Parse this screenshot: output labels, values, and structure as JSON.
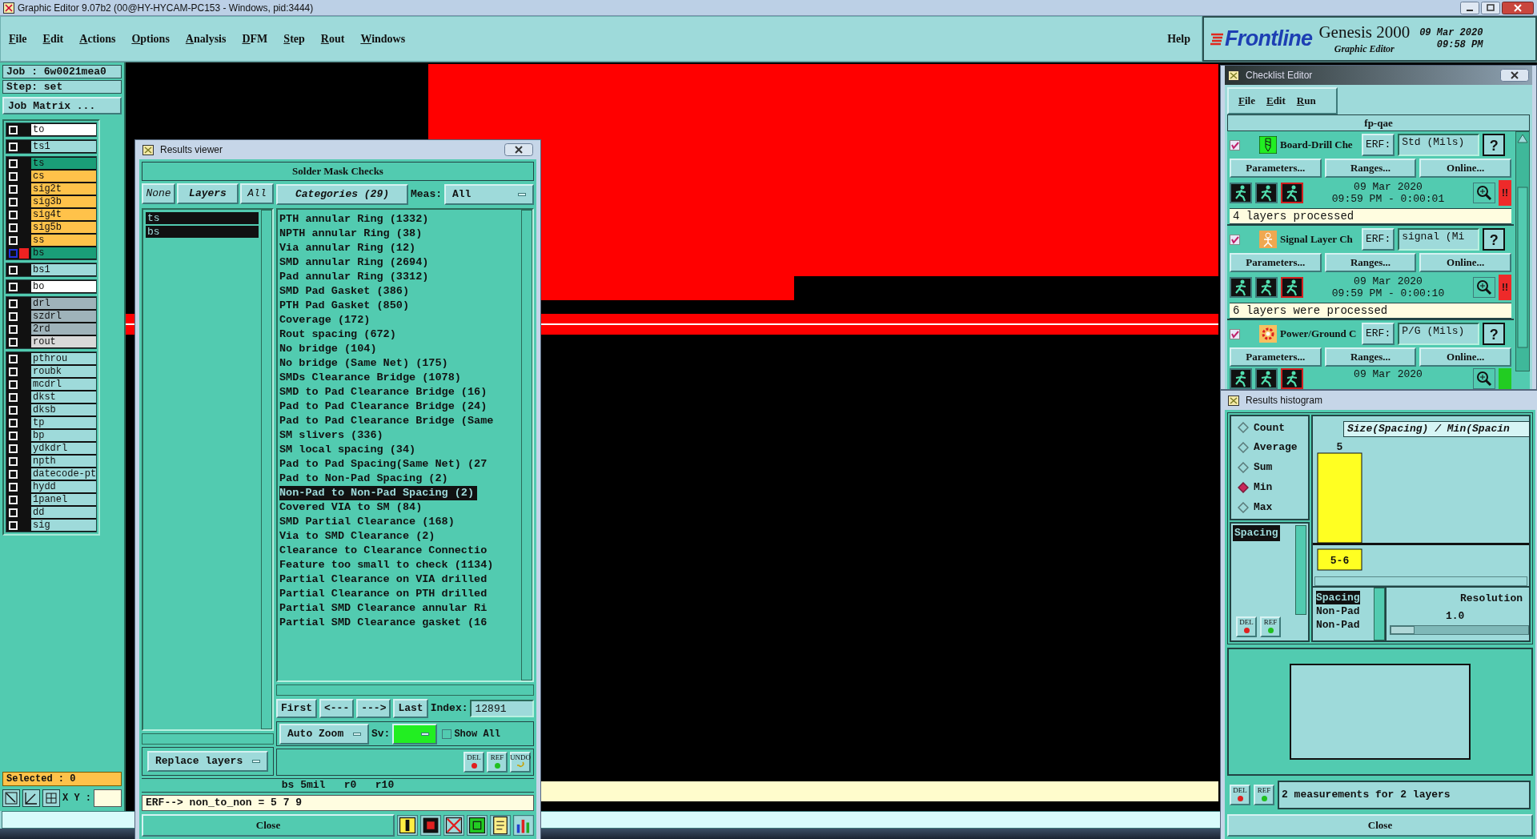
{
  "window": {
    "title": "Graphic Editor 9.07b2 (00@HY-HYCAM-PC153 - Windows, pid:3444)"
  },
  "menu": [
    "File",
    "Edit",
    "Actions",
    "Options",
    "Analysis",
    "DFM",
    "Step",
    "Rout",
    "Windows"
  ],
  "help": "Help",
  "brand": {
    "logo": "Frontline",
    "product": "Genesis 2000",
    "subtitle": "Graphic Editor",
    "date": "09 Mar 2020",
    "time": "09:58 PM"
  },
  "job_panel": {
    "job": "Job : 6w0021mea0",
    "step": "Step: set",
    "matrix_button": "Job Matrix ...",
    "layer_groups": [
      [
        {
          "name": "to",
          "color": "#ffffff",
          "checked": false,
          "work": false
        }
      ],
      [
        {
          "name": "ts1",
          "color": "#9edada",
          "checked": false,
          "work": false
        }
      ],
      [
        {
          "name": "ts",
          "color": "#1a9e78",
          "checked": false,
          "work": false
        },
        {
          "name": "cs",
          "color": "#ffc24a",
          "checked": false,
          "work": false
        },
        {
          "name": "sig2t",
          "color": "#ffc24a",
          "checked": false,
          "work": false
        },
        {
          "name": "sig3b",
          "color": "#ffc24a",
          "checked": false,
          "work": false
        },
        {
          "name": "sig4t",
          "color": "#ffc24a",
          "checked": false,
          "work": false
        },
        {
          "name": "sig5b",
          "color": "#ffc24a",
          "checked": false,
          "work": false
        },
        {
          "name": "ss",
          "color": "#ffc24a",
          "checked": false,
          "work": false
        },
        {
          "name": "bs",
          "color": "#1a9e78",
          "checked": false,
          "work": true
        }
      ],
      [
        {
          "name": "bs1",
          "color": "#9edada",
          "checked": false,
          "work": false
        }
      ],
      [
        {
          "name": "bo",
          "color": "#ffffff",
          "checked": false,
          "work": false
        }
      ],
      [
        {
          "name": "drl",
          "color": "#9fb3ba",
          "checked": false,
          "work": false
        },
        {
          "name": "szdrl",
          "color": "#9fb3ba",
          "checked": false,
          "work": false
        },
        {
          "name": "2rd",
          "color": "#9fb3ba",
          "checked": false,
          "work": false
        },
        {
          "name": "rout",
          "color": "#d9d9d9",
          "checked": false,
          "work": false
        }
      ],
      [
        {
          "name": "pthrou",
          "color": "#9edada",
          "checked": false,
          "work": false
        },
        {
          "name": "roubk",
          "color": "#9edada",
          "checked": false,
          "work": false
        },
        {
          "name": "mcdrl",
          "color": "#9edada",
          "checked": false,
          "work": false
        },
        {
          "name": "dkst",
          "color": "#9edada",
          "checked": false,
          "work": false
        },
        {
          "name": "dksb",
          "color": "#9edada",
          "checked": false,
          "work": false
        },
        {
          "name": "tp",
          "color": "#9edada",
          "checked": false,
          "work": false
        },
        {
          "name": "bp",
          "color": "#9edada",
          "checked": false,
          "work": false
        },
        {
          "name": "ydkdrl",
          "color": "#9edada",
          "checked": false,
          "work": false
        },
        {
          "name": "npth",
          "color": "#9edada",
          "checked": false,
          "work": false
        },
        {
          "name": "datecode-pt",
          "color": "#9edada",
          "checked": false,
          "work": false
        },
        {
          "name": "hydd",
          "color": "#9edada",
          "checked": false,
          "work": false
        },
        {
          "name": "1panel",
          "color": "#9edada",
          "checked": false,
          "work": false
        },
        {
          "name": "dd",
          "color": "#9edada",
          "checked": false,
          "work": false
        },
        {
          "name": "sig",
          "color": "#9edada",
          "checked": false,
          "work": false
        }
      ]
    ],
    "selected": "Selected : 0",
    "xy_label": "X Y :"
  },
  "results_viewer": {
    "title": "Results viewer",
    "heading": "Solder Mask Checks",
    "layer_buttons": [
      "None",
      "Layers",
      "All"
    ],
    "layers": [
      {
        "name": "ts",
        "selected": true
      },
      {
        "name": "bs",
        "selected": true
      }
    ],
    "categories_button": "Categories (29)",
    "meas_label": "Meas:",
    "meas_value": "All",
    "categories": [
      {
        "label": "PTH annular Ring (1332)",
        "selected": false
      },
      {
        "label": "NPTH annular Ring (38)",
        "selected": false
      },
      {
        "label": "Via annular Ring (12)",
        "selected": false
      },
      {
        "label": "SMD annular Ring (2694)",
        "selected": false
      },
      {
        "label": "Pad annular Ring (3312)",
        "selected": false
      },
      {
        "label": "SMD Pad Gasket (386)",
        "selected": false
      },
      {
        "label": "PTH Pad Gasket (850)",
        "selected": false
      },
      {
        "label": "Coverage (172)",
        "selected": false
      },
      {
        "label": "Rout spacing (672)",
        "selected": false
      },
      {
        "label": "No bridge (104)",
        "selected": false
      },
      {
        "label": "No bridge (Same Net) (175)",
        "selected": false
      },
      {
        "label": "SMDs Clearance Bridge (1078)",
        "selected": false
      },
      {
        "label": "SMD to Pad Clearance Bridge (16)",
        "selected": false
      },
      {
        "label": "Pad to Pad Clearance Bridge (24)",
        "selected": false
      },
      {
        "label": "Pad to Pad Clearance Bridge (Same",
        "selected": false
      },
      {
        "label": "SM slivers (336)",
        "selected": false
      },
      {
        "label": "SM local spacing (34)",
        "selected": false
      },
      {
        "label": "Pad to Pad Spacing(Same Net) (27",
        "selected": false
      },
      {
        "label": "Pad to Non-Pad Spacing (2)",
        "selected": false
      },
      {
        "label": "Non-Pad to Non-Pad Spacing (2)",
        "selected": true
      },
      {
        "label": "Covered VIA to SM (84)",
        "selected": false
      },
      {
        "label": "SMD Partial Clearance (168)",
        "selected": false
      },
      {
        "label": "Via to SMD Clearance (2)",
        "selected": false
      },
      {
        "label": "Clearance to Clearance Connectio",
        "selected": false
      },
      {
        "label": "Feature too small to check (1134)",
        "selected": false
      },
      {
        "label": "Partial Clearance on VIA drilled",
        "selected": false
      },
      {
        "label": "Partial Clearance on PTH drilled",
        "selected": false
      },
      {
        "label": "Partial SMD Clearance annular Ri",
        "selected": false
      },
      {
        "label": "Partial SMD Clearance gasket (16",
        "selected": false
      }
    ],
    "nav_buttons": [
      "First",
      "<---",
      "--->",
      "Last"
    ],
    "index_label": "Index:",
    "index_value": "12891",
    "zoom_mode": "Auto Zoom",
    "sv_label": "Sv:",
    "show_all": {
      "label": "Show All",
      "checked": false
    },
    "replace_mode": "Replace layers",
    "action_buttons": [
      "DEL",
      "REF",
      "UNDO"
    ],
    "status": "bs 5mil   r0   r10",
    "erf_line": "ERF--> non_to_non = 5 7 9",
    "close": "Close"
  },
  "checklist_editor": {
    "title": "Checklist Editor",
    "menu": [
      "File",
      "Edit",
      "Run"
    ],
    "name": "fp-qae",
    "checks": [
      {
        "kind": "drill",
        "name": "Board-Drill Che",
        "checked": true,
        "erf_label": "ERF:",
        "erf": "Std (Mils)",
        "help": "?",
        "buttons": [
          "Parameters...",
          "Ranges...",
          "Online..."
        ],
        "date": "09 Mar 2020",
        "time": "09:59 PM - 0:00:01",
        "color": "#ee2a2a",
        "flag": "!!",
        "message": "4 layers processed"
      },
      {
        "kind": "signal",
        "name": "Signal Layer Ch",
        "checked": true,
        "erf_label": "ERF:",
        "erf": "signal (Mi",
        "help": "?",
        "buttons": [
          "Parameters...",
          "Ranges...",
          "Online..."
        ],
        "date": "09 Mar 2020",
        "time": "09:59 PM - 0:00:10",
        "color": "#ee2a2a",
        "flag": "!!",
        "message": "6 layers were processed"
      },
      {
        "kind": "power",
        "name": "Power/Ground C",
        "checked": true,
        "erf_label": "ERF:",
        "erf": "P/G (Mils)",
        "help": "?",
        "buttons": [
          "Parameters...",
          "Ranges...",
          "Online..."
        ],
        "date": "09 Mar 2020",
        "color": "#22cc22"
      }
    ]
  },
  "histogram": {
    "title": "Results histogram",
    "modes": [
      {
        "label": "Count",
        "selected": false
      },
      {
        "label": "Average",
        "selected": false
      },
      {
        "label": "Sum",
        "selected": false
      },
      {
        "label": "Min",
        "selected": true
      },
      {
        "label": "Max",
        "selected": false
      }
    ],
    "measures": [
      {
        "label": "Spacing",
        "selected": true
      }
    ],
    "chart": {
      "title": "Size(Spacing) / Min(Spacin",
      "bars": [
        {
          "value_label": "5",
          "category": "5-6"
        }
      ]
    },
    "fields": [
      {
        "label": "Spacing",
        "selected": true
      },
      {
        "label": "Non-Pad",
        "selected": false
      },
      {
        "label": "Non-Pad",
        "selected": false
      }
    ],
    "resolution_label": "Resolution",
    "resolution_value": "1.0",
    "resolution": {
      "level": 0.0
    },
    "list_buttons": [
      "DEL",
      "REF"
    ],
    "footer_buttons": [
      "DEL",
      "REF"
    ],
    "status": "2 measurements for 2 layers",
    "close": "Close"
  }
}
